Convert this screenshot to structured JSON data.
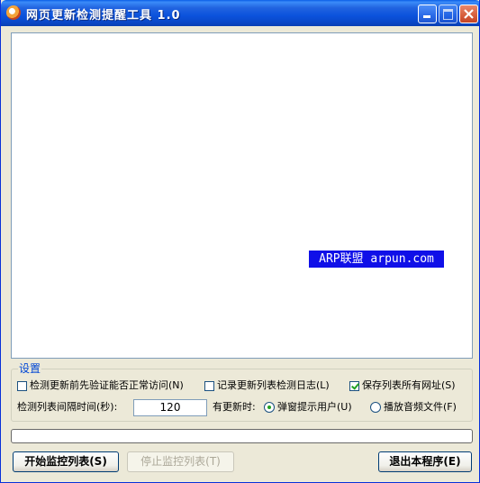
{
  "window": {
    "title": "网页更新检测提醒工具 1.0"
  },
  "content": {
    "watermark": "ARP联盟 arpun.com"
  },
  "settings": {
    "group_label": "设置",
    "check_access": {
      "label": "检测更新前先验证能否正常访问(N)",
      "checked": false
    },
    "log_updates": {
      "label": "记录更新列表检测日志(L)",
      "checked": false
    },
    "save_urls": {
      "label": "保存列表所有网址(S)",
      "checked": true
    },
    "interval_label": "检测列表间隔时间(秒):",
    "interval_value": "120",
    "on_update_label": "有更新时:",
    "notify_popup": {
      "label": "弹窗提示用户(U)",
      "selected": true
    },
    "notify_sound": {
      "label": "播放音频文件(F)",
      "selected": false
    }
  },
  "progress": {
    "value": 0
  },
  "buttons": {
    "start": "开始监控列表(S)",
    "stop": "停止监控列表(T)",
    "exit": "退出本程序(E)"
  },
  "colors": {
    "titlebar": "#0a5ee6",
    "watermark_bg": "#1010e8",
    "group_label": "#0046d5",
    "check_green": "#21a121"
  }
}
